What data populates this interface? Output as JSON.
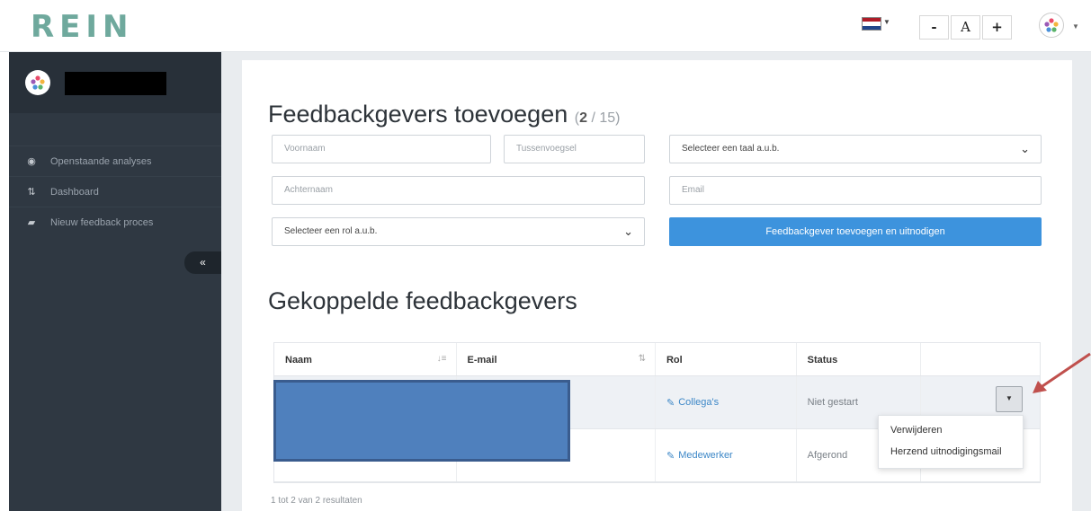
{
  "header": {
    "logo": "REIN",
    "font_controls": [
      "-",
      "A",
      "+"
    ],
    "language_flag": "netherlands-flag-icon"
  },
  "sidebar": {
    "items": [
      {
        "icon": "dashboard-gauge-icon",
        "label": "Openstaande analyses"
      },
      {
        "icon": "sliders-icon",
        "label": "Dashboard"
      },
      {
        "icon": "comment-icon",
        "label": "Nieuw feedback proces"
      }
    ],
    "collapse_label": "«"
  },
  "add_section": {
    "title": "Feedbackgevers toevoegen",
    "count_current": "2",
    "count_total": "/ 15",
    "fields": {
      "first_name_placeholder": "Voornaam",
      "middle_placeholder": "Tussenvoegsel",
      "language_select": "Selecteer een taal a.u.b.",
      "last_name_placeholder": "Achternaam",
      "email_placeholder": "Email",
      "role_select": "Selecteer een rol a.u.b."
    },
    "submit_label": "Feedbackgever toevoegen en uitnodigen"
  },
  "linked_section": {
    "title": "Gekoppelde feedbackgevers",
    "columns": [
      "Naam",
      "E-mail",
      "Rol",
      "Status"
    ],
    "rows": [
      {
        "role": "Collega's",
        "status": "Niet gestart"
      },
      {
        "role": "Medewerker",
        "status": "Afgerond"
      }
    ],
    "dropdown_menu": [
      "Verwijderen",
      "Herzend uitnodigingsmail"
    ],
    "footer": "1 tot 2 van 2 resultaten"
  },
  "colors": {
    "accent": "#3d93dd",
    "sidebar": "#2f3842",
    "annotation_arrow": "#c0504d",
    "redaction": "#4f80bd"
  }
}
